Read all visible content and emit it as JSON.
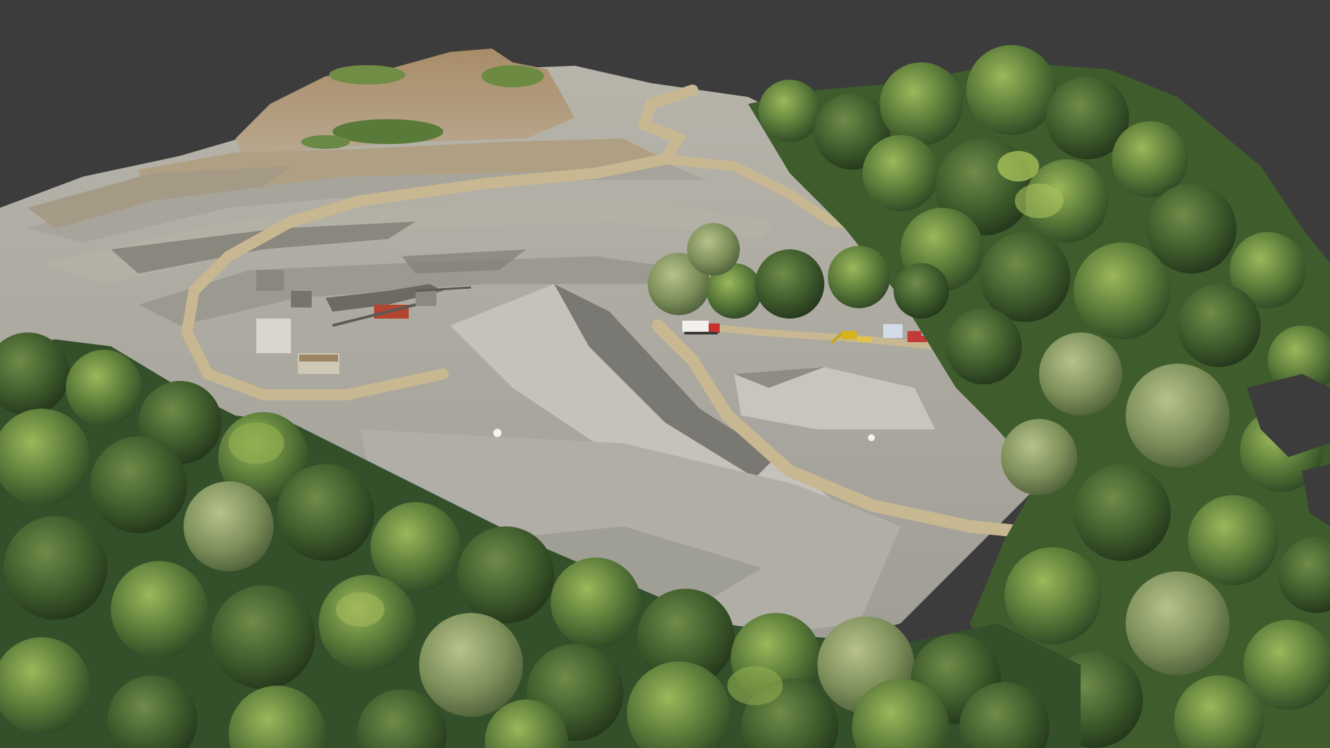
{
  "scene": {
    "subject": "photogrammetry-3d-model-quarry",
    "view": "oblique-aerial"
  },
  "colors": {
    "background": "#3c3c3c",
    "rock_face": "#a08a6e",
    "gravel": "#a9a8a2",
    "gravel_light": "#c2c0b8",
    "shadow": "#6f6e69",
    "road": "#c9b995",
    "forest_dark": "#2f4a25",
    "forest_mid": "#4f6e35",
    "forest_light": "#8fae4e",
    "truck_white": "#f2f0ea",
    "truck_red": "#c8322c",
    "excavator_yellow": "#d6b21e"
  },
  "objects": [
    {
      "name": "quarry-pit",
      "kind": "terrain"
    },
    {
      "name": "upper-rock-face",
      "kind": "terrain"
    },
    {
      "name": "haul-road",
      "kind": "terrain"
    },
    {
      "name": "gravel-stockpiles",
      "kind": "terrain"
    },
    {
      "name": "crushing-plant",
      "kind": "equipment"
    },
    {
      "name": "dump-truck",
      "kind": "vehicle"
    },
    {
      "name": "excavator",
      "kind": "vehicle"
    },
    {
      "name": "site-cabin",
      "kind": "structure"
    },
    {
      "name": "forest-canopy",
      "kind": "vegetation"
    }
  ]
}
